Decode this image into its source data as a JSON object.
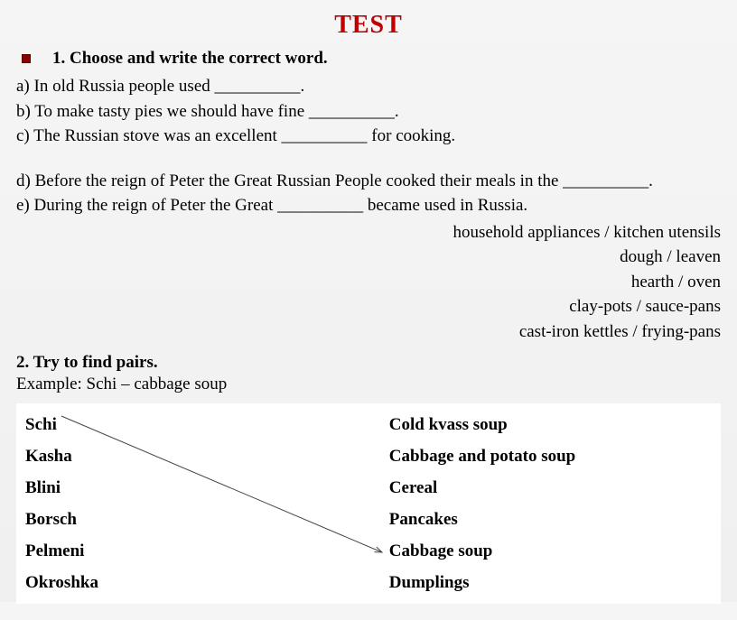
{
  "title": "TEST",
  "q1": {
    "heading": "1. Choose and write the correct word.",
    "a": "a) In old Russia people used __________.",
    "b": "b) To make tasty pies we should have fine __________.",
    "c": "c) The Russian stove was an excellent  __________ for cooking.",
    "d": "d) Before the reign of Peter the Great Russian People cooked their meals in the __________.",
    "e": "e) During the reign of Peter the Great __________ became used in Russia."
  },
  "options": {
    "o1": "household appliances / kitchen utensils",
    "o2": "dough / leaven",
    "o3": "hearth / oven",
    "o4": "clay-pots / sauce-pans",
    "o5": "cast-iron kettles / frying-pans"
  },
  "q2": {
    "heading": "2. Try to find pairs.",
    "example": "Example: Schi – cabbage soup"
  },
  "pairs": {
    "left": [
      "Schi",
      "Kasha",
      "Blini",
      "Borsch",
      "Pelmeni",
      "Okroshka"
    ],
    "right": [
      "Cold kvass soup",
      "Cabbage  and potato soup",
      "Cereal",
      "Pancakes",
      "Cabbage soup",
      "Dumplings"
    ]
  }
}
